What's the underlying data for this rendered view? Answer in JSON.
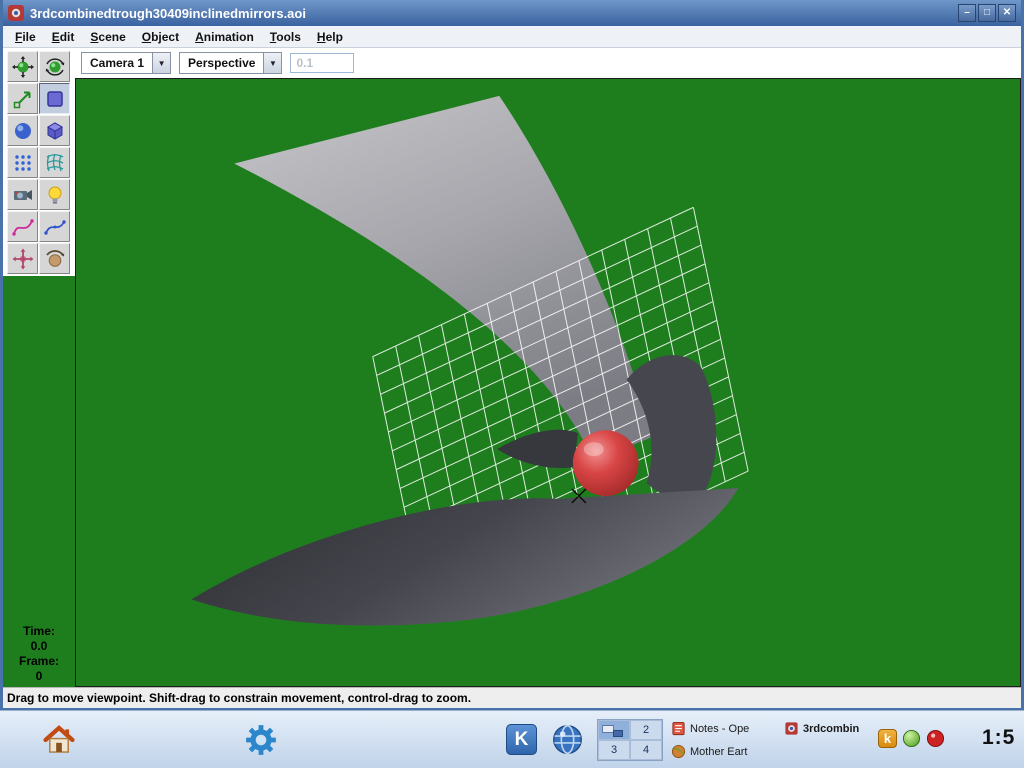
{
  "window": {
    "title": "3rdcombinedtrough30409inclinedmirrors.aoi",
    "buttons": {
      "minimize": "–",
      "maximize": "□",
      "close": "✕"
    }
  },
  "menubar": {
    "items": [
      "File",
      "Edit",
      "Scene",
      "Object",
      "Animation",
      "Tools",
      "Help"
    ]
  },
  "viewport_header": {
    "camera_value": "Camera 1",
    "view_value": "Perspective",
    "scale_value": "0.1"
  },
  "palette": {
    "tools": [
      "move-object-tool",
      "rotate-object-tool",
      "resize-object-tool",
      "create-cube-tool",
      "create-sphere-tool",
      "create-cylinder-tool",
      "create-spline-mesh-tool",
      "create-polymesh-tool",
      "create-camera-tool",
      "create-light-tool",
      "create-curve-tool",
      "create-polygon-tool",
      "move-viewpoint-tool",
      "rotate-viewpoint-tool"
    ],
    "selected": "create-cube-tool"
  },
  "timeline": {
    "time_label": "Time:",
    "time_value": "0.0",
    "frame_label": "Frame:",
    "frame_value": "0"
  },
  "statusbar": {
    "message": "Drag to move viewpoint.  Shift-drag to constrain movement, control-drag to zoom."
  },
  "scene": {
    "background_color": "#1e7e1e",
    "sphere_color": "#cc3333",
    "grid_color": "#ffffff",
    "mirror_light_color": "#b0b0b6",
    "mirror_dark_color": "#3c3c44"
  },
  "taskbar": {
    "pager": {
      "labels": [
        "2",
        "3",
        "4"
      ],
      "active_desktop": "1"
    },
    "tasks": [
      {
        "label": "Notes - Ope",
        "icon": "notes-icon"
      },
      {
        "label": "3rdcombin",
        "icon": "aoi-task-icon",
        "active": true
      },
      {
        "label": "Mother Eart",
        "icon": "planet-icon"
      }
    ],
    "tray": [
      "k-app-icon",
      "green-status-icon",
      "red-status-icon"
    ],
    "clock": "1:5"
  }
}
